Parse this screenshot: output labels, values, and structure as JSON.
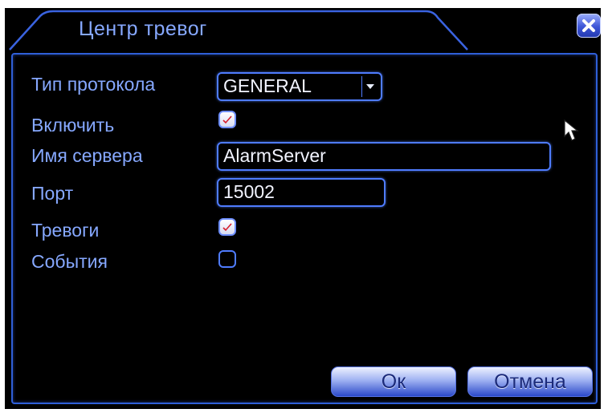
{
  "dialog": {
    "title": "Центр тревог"
  },
  "fields": {
    "protocol_label": "Тип протокола",
    "protocol_value": "GENERAL",
    "enable_label": "Включить",
    "enable_checked": true,
    "server_label": "Имя сервера",
    "server_value": "AlarmServer",
    "port_label": "Порт",
    "port_value": "15002",
    "alarms_label": "Тревоги",
    "alarms_checked": true,
    "events_label": "События",
    "events_checked": false
  },
  "buttons": {
    "ok_label": "Ок",
    "cancel_label": "Отмена"
  },
  "icons": {
    "close": "close-icon",
    "cursor": "mouse-pointer-icon"
  },
  "colors": {
    "background": "#000000",
    "label": "#86a8ff",
    "accent": "#4f7cff"
  }
}
